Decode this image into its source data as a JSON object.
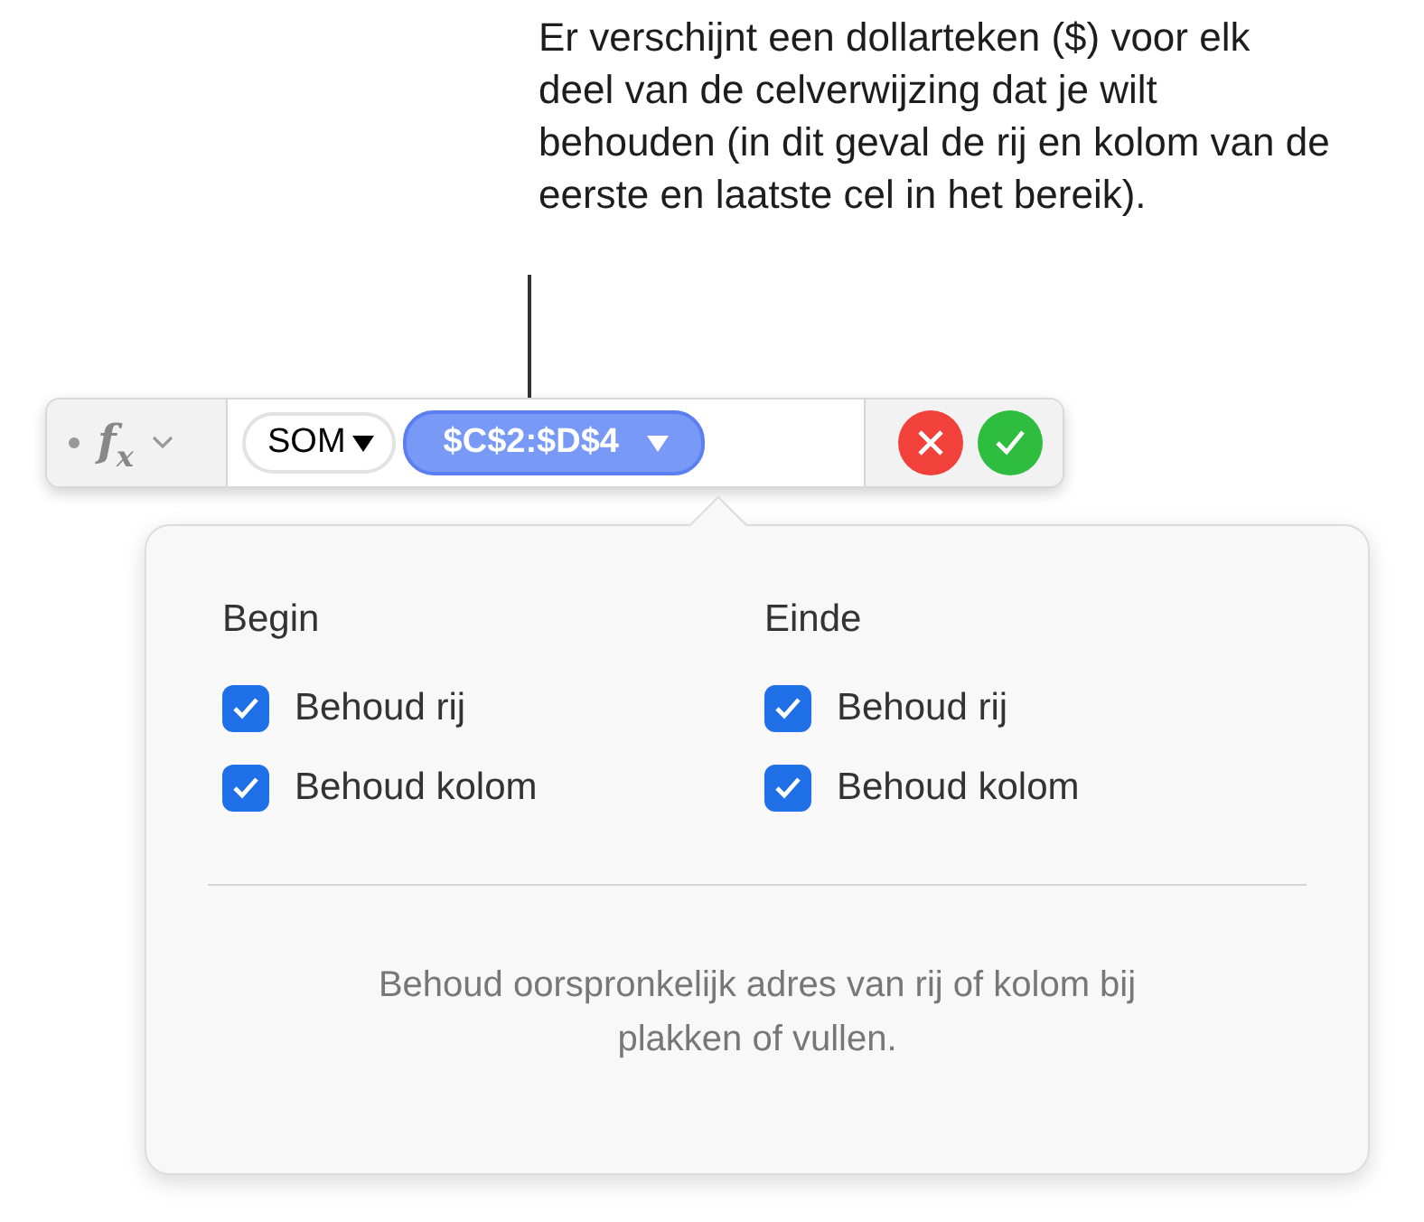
{
  "callout": "Er verschijnt een dollarteken ($) voor elk deel van de celverwijzing dat je wilt behouden (in dit geval de rij en kolom van de eerste en laatste cel in het bereik).",
  "formula_bar": {
    "function_label": "f$_{x}$",
    "function_token": "SOM",
    "range_token": "$C$2:$D$4"
  },
  "popover": {
    "groups": [
      {
        "title": "Begin",
        "options": [
          {
            "label": "Behoud rij",
            "checked": true
          },
          {
            "label": "Behoud kolom",
            "checked": true
          }
        ]
      },
      {
        "title": "Einde",
        "options": [
          {
            "label": "Behoud rij",
            "checked": true
          },
          {
            "label": "Behoud kolom",
            "checked": true
          }
        ]
      }
    ],
    "note": "Behoud oorspronkelijk adres van rij of kolom bij plakken of vullen."
  }
}
